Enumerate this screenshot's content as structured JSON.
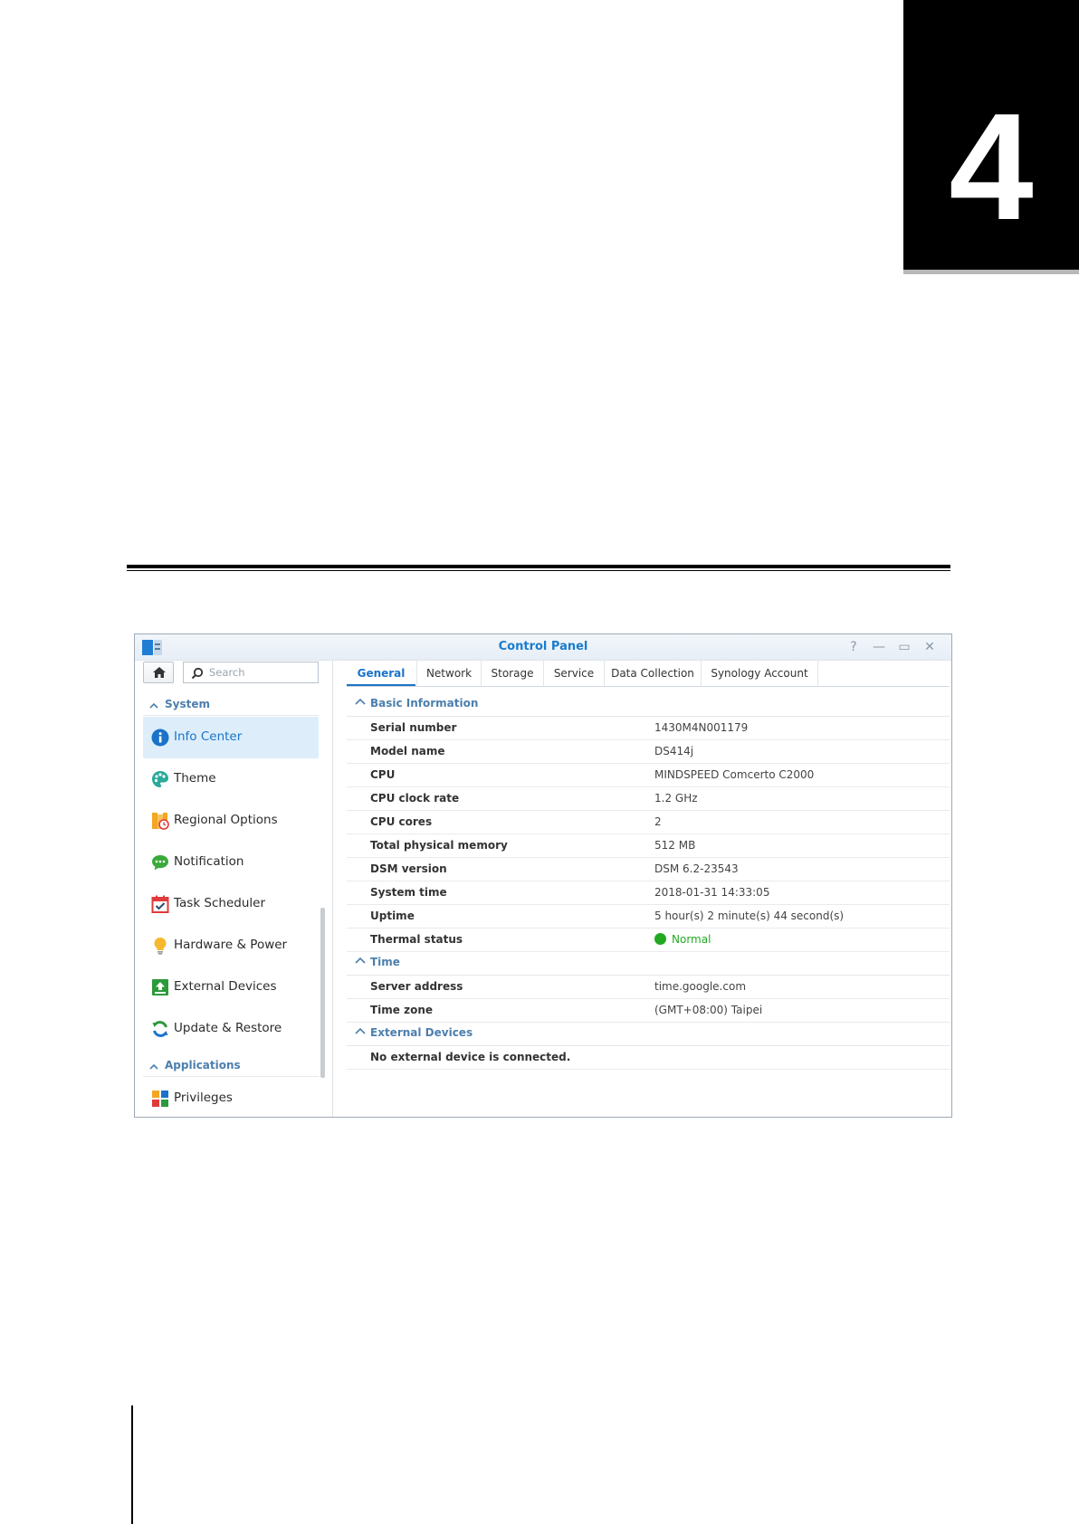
{
  "chapter": {
    "number": "4"
  },
  "window": {
    "title": "Control Panel",
    "controls": {
      "help": "?",
      "minimize": "—",
      "maximize": "▭",
      "close": "✕"
    }
  },
  "sidebar": {
    "search_placeholder": "Search",
    "categories": [
      {
        "label": "System"
      },
      {
        "label": "Applications"
      }
    ],
    "items": [
      {
        "label": "Info Center",
        "icon": "info-icon",
        "active": true
      },
      {
        "label": "Theme",
        "icon": "palette-icon"
      },
      {
        "label": "Regional Options",
        "icon": "calendar-clock-icon"
      },
      {
        "label": "Notification",
        "icon": "chat-bubble-icon"
      },
      {
        "label": "Task Scheduler",
        "icon": "calendar-check-icon"
      },
      {
        "label": "Hardware & Power",
        "icon": "lightbulb-icon"
      },
      {
        "label": "External Devices",
        "icon": "upload-icon"
      },
      {
        "label": "Update & Restore",
        "icon": "refresh-icon"
      },
      {
        "label": "Privileges",
        "icon": "grid-icon"
      }
    ]
  },
  "tabs": [
    {
      "label": "General",
      "active": true
    },
    {
      "label": "Network"
    },
    {
      "label": "Storage"
    },
    {
      "label": "Service"
    },
    {
      "label": "Data Collection"
    },
    {
      "label": "Synology Account"
    }
  ],
  "basic_information": {
    "title": "Basic Information",
    "rows": [
      {
        "key": "Serial number",
        "value": "1430M4N001179"
      },
      {
        "key": "Model name",
        "value": "DS414j"
      },
      {
        "key": "CPU",
        "value": "MINDSPEED Comcerto C2000"
      },
      {
        "key": "CPU clock rate",
        "value": "1.2 GHz"
      },
      {
        "key": "CPU cores",
        "value": "2"
      },
      {
        "key": "Total physical memory",
        "value": "512 MB"
      },
      {
        "key": "DSM version",
        "value": "DSM 6.2-23543"
      },
      {
        "key": "System time",
        "value": "2018-01-31 14:33:05"
      },
      {
        "key": "Uptime",
        "value": "5 hour(s) 2 minute(s) 44 second(s)"
      },
      {
        "key": "Thermal status",
        "value": "Normal",
        "status_color": "#22aa22"
      }
    ]
  },
  "time": {
    "title": "Time",
    "rows": [
      {
        "key": "Server address",
        "value": "time.google.com"
      },
      {
        "key": "Time zone",
        "value": "(GMT+08:00) Taipei"
      }
    ]
  },
  "external_devices": {
    "title": "External Devices",
    "message": "No external device is connected."
  }
}
